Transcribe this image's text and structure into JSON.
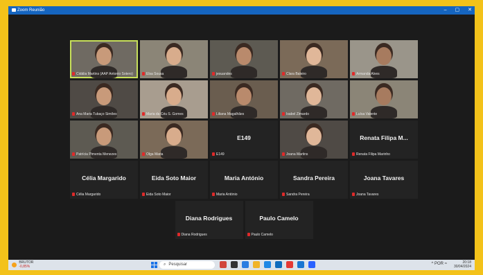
{
  "window": {
    "title": "Zoom Reunião",
    "controls": [
      "–",
      "▢",
      "✕"
    ]
  },
  "tiles": [
    {
      "row": 0,
      "col": 1,
      "caption": "Cidália Martins (AAP Antonio Sotero)",
      "type": "video",
      "active": true
    },
    {
      "row": 0,
      "col": 2,
      "caption": "Elsa Sousa",
      "type": "video"
    },
    {
      "row": 0,
      "col": 3,
      "caption": "jesuandes",
      "type": "video"
    },
    {
      "row": 0,
      "col": 4,
      "caption": "Clara Baleiro",
      "type": "video"
    },
    {
      "row": 0,
      "col": 5,
      "caption": "Armanda Alves",
      "type": "video"
    },
    {
      "row": 1,
      "col": 1,
      "caption": "Ana Maria Tubaço Simões",
      "type": "video"
    },
    {
      "row": 1,
      "col": 2,
      "caption": "Maria da Céu S. Gomes",
      "type": "video"
    },
    {
      "row": 1,
      "col": 3,
      "caption": "Liliana Magalhães",
      "type": "video"
    },
    {
      "row": 1,
      "col": 4,
      "caption": "Isabel Zimardo",
      "type": "video"
    },
    {
      "row": 1,
      "col": 5,
      "caption": "Luísa Valente",
      "type": "video"
    },
    {
      "row": 2,
      "col": 1,
      "caption": "Patrícia Pimenta Menezes",
      "type": "video"
    },
    {
      "row": 2,
      "col": 2,
      "caption": "Olga Maria",
      "type": "video"
    },
    {
      "row": 2,
      "col": 3,
      "caption": "E149",
      "bigname": "E149",
      "type": "name"
    },
    {
      "row": 2,
      "col": 4,
      "caption": "Joana Martins",
      "type": "video"
    },
    {
      "row": 2,
      "col": 5,
      "caption": "Renata Filipa Marinho",
      "bigname": "Renata Filipa M...",
      "type": "name"
    },
    {
      "row": 3,
      "col": 1,
      "caption": "Célia Margarido",
      "bigname": "Célia Margarido",
      "type": "name"
    },
    {
      "row": 3,
      "col": 2,
      "caption": "Eida Soto Maior",
      "bigname": "Eida Soto Maior",
      "type": "name"
    },
    {
      "row": 3,
      "col": 3,
      "caption": "Maria António",
      "bigname": "Maria António",
      "type": "name"
    },
    {
      "row": 3,
      "col": 4,
      "caption": "Sandra Pereira",
      "bigname": "Sandra Pereira",
      "type": "name"
    },
    {
      "row": 3,
      "col": 5,
      "caption": "Joana Tavares",
      "bigname": "Joana Tavares",
      "type": "name"
    },
    {
      "row": 4,
      "col": 2.5,
      "caption": "Diana Rodrigues",
      "bigname": "Diana Rodrigues",
      "type": "name"
    },
    {
      "row": 4,
      "col": 3.5,
      "caption": "Paulo Camelo",
      "bigname": "Paulo Camelo",
      "type": "name"
    }
  ],
  "taskbar": {
    "weather_title": "BRUTOR",
    "weather_value": "-0,85%",
    "search_placeholder": "Pesquisar",
    "time": "20:18",
    "date": "30/04/2024",
    "lang": "POR"
  },
  "colors": {
    "active_outline": "#c8e05a",
    "mic_muted": "#e02a2a",
    "title_bar": "#1565c0"
  }
}
